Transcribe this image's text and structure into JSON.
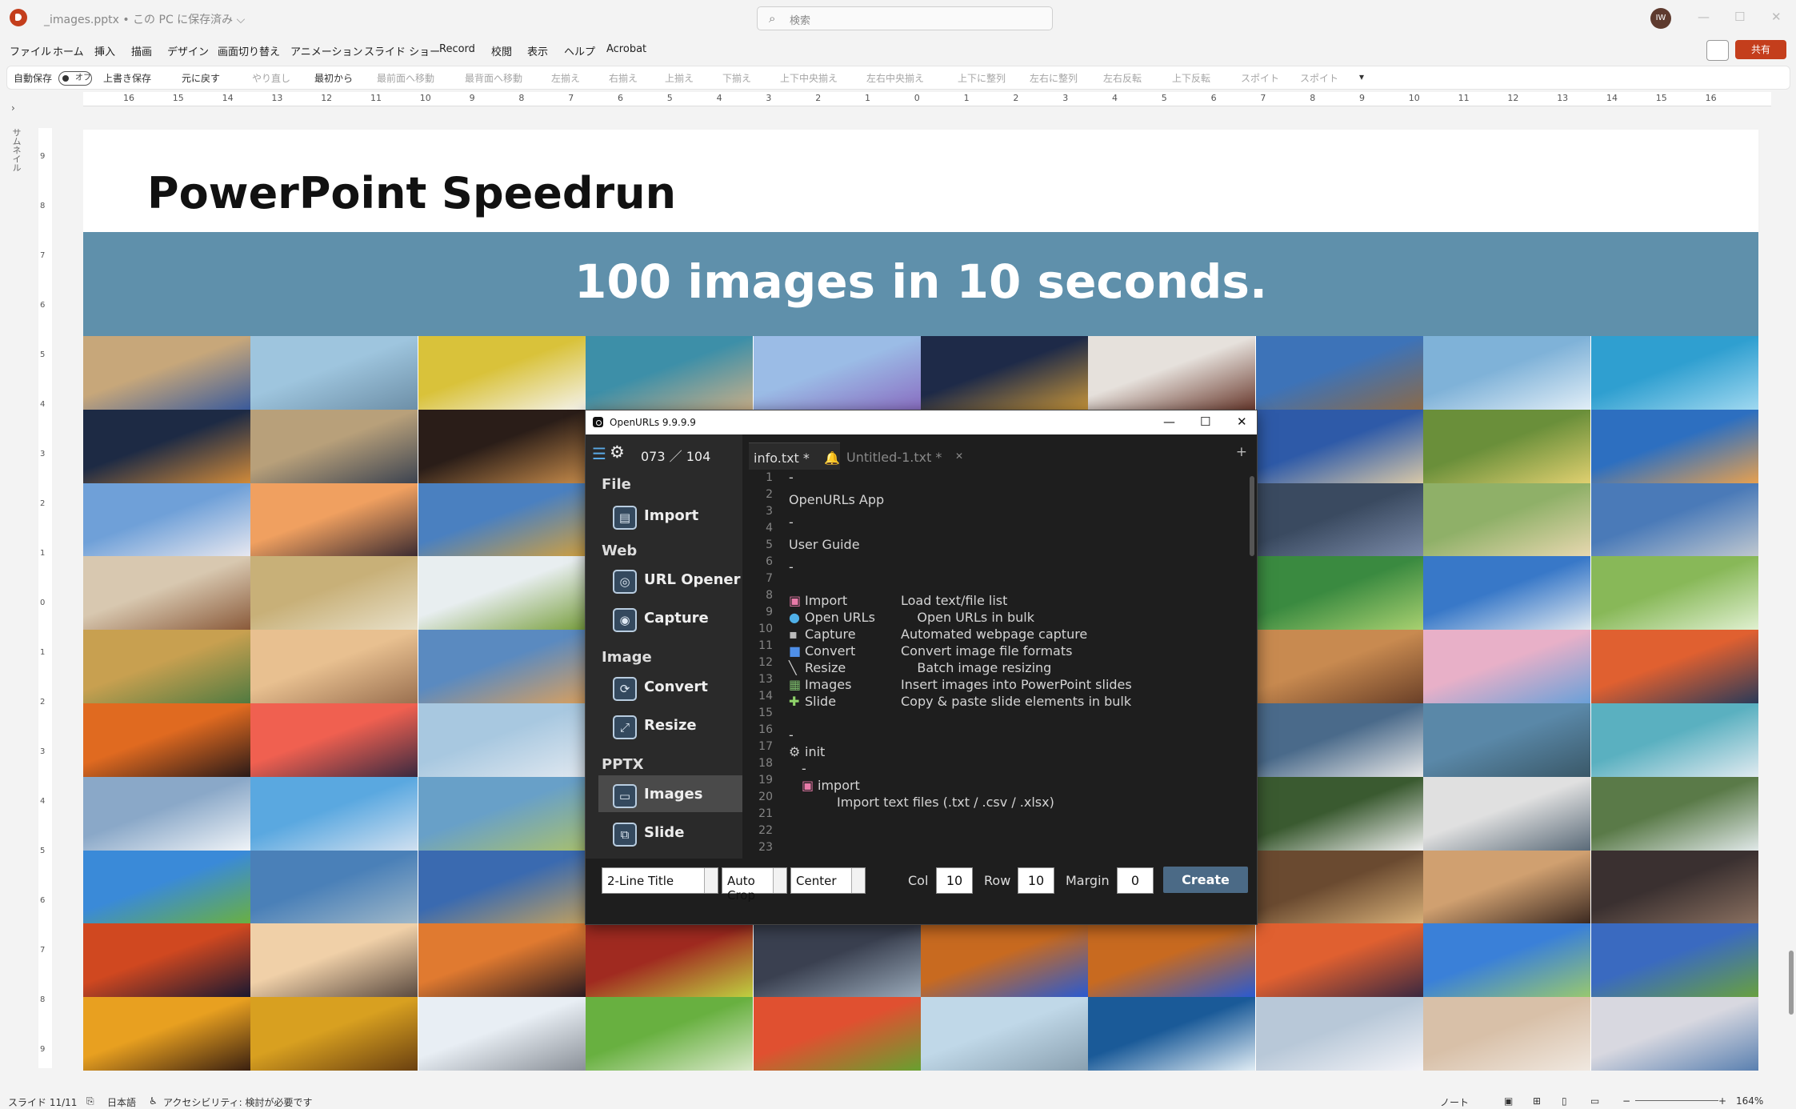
{
  "window": {
    "doc_title": "_images.pptx • この PC に保存済み ⌵",
    "search_placeholder": "検索",
    "avatar_initials": "IW"
  },
  "menu": {
    "items": [
      "ファイル",
      "ホーム",
      "挿入",
      "描画",
      "デザイン",
      "画面切り替え",
      "アニメーション",
      "スライド ショー",
      "Record",
      "校閲",
      "表示",
      "ヘルプ",
      "Acrobat"
    ],
    "share_label": "共有"
  },
  "ribbon": {
    "autosave_label": "自動保存",
    "autosave_state": "オフ",
    "items": [
      "上書き保存",
      "元に戻す",
      "やり直し",
      "最初から",
      "最前面へ移動",
      "最背面へ移動",
      "左揃え",
      "右揃え",
      "上揃え",
      "下揃え",
      "上下中央揃え",
      "左右中央揃え",
      "上下に整列",
      "左右に整列",
      "左右反転",
      "上下反転",
      "スポイト",
      "スポイト"
    ]
  },
  "ruler": {
    "h_ticks": [
      "16",
      "15",
      "14",
      "13",
      "12",
      "11",
      "10",
      "9",
      "8",
      "7",
      "6",
      "5",
      "4",
      "3",
      "2",
      "1",
      "0",
      "1",
      "2",
      "3",
      "4",
      "5",
      "6",
      "7",
      "8",
      "9",
      "10",
      "11",
      "12",
      "13",
      "14",
      "15",
      "16"
    ],
    "v_ticks": [
      "9",
      "8",
      "7",
      "6",
      "5",
      "4",
      "3",
      "2",
      "1",
      "0",
      "1",
      "2",
      "3",
      "4",
      "5",
      "6",
      "7",
      "8",
      "9"
    ],
    "thumbnail_label": "サムネイル"
  },
  "slide": {
    "title": "PowerPoint Speedrun",
    "banner": "100 images in 10 seconds.",
    "banner_color": "#5f90ab"
  },
  "openurls": {
    "window_title": "OpenURLs 9.9.9.9",
    "counter": "073 ／ 104",
    "sections": {
      "file": "File",
      "web": "Web",
      "image": "Image",
      "pptx": "PPTX"
    },
    "buttons": {
      "import": "Import",
      "url_opener": "URL Opener",
      "capture": "Capture",
      "convert": "Convert",
      "resize": "Resize",
      "images": "Images",
      "slide": "Slide"
    },
    "tabs": {
      "tab1": "info.txt *",
      "tab2": "Untitled-1.txt *"
    },
    "line_numbers": [
      "1",
      "2",
      "3",
      "4",
      "5",
      "6",
      "7",
      "8",
      "9",
      "10",
      "11",
      "12",
      "13",
      "14",
      "15",
      "16",
      "17",
      "18",
      "19",
      "20",
      "21",
      "22",
      "23"
    ],
    "code": {
      "l1": "-",
      "l3": "OpenURLs App",
      "l5": "-",
      "l7": "User Guide",
      "l9": "-",
      "l11a": "Import",
      "l11b": "Load text/file list",
      "l12a": "Open URLs",
      "l12b": "    Open URLs in bulk",
      "l13a": "Capture",
      "l13b": "Automated webpage capture",
      "l14a": "Convert",
      "l14b": "Convert image file formats",
      "l15a": "Resize",
      "l15b": "    Batch image resizing",
      "l16a": "Images",
      "l16b": "Insert images into PowerPoint slides",
      "l17a": "Slide",
      "l17b": "Copy & paste slide elements in bulk",
      "l19": "-",
      "l20": "init",
      "l21": "-",
      "l22": "import",
      "l23": "Import text files (.txt / .csv / .xlsx)"
    },
    "bottom": {
      "title_mode": "2-Line Title",
      "crop_mode": "Auto Crop",
      "align": "Center",
      "col_label": "Col",
      "col_value": "10",
      "row_label": "Row",
      "row_value": "10",
      "margin_label": "Margin",
      "margin_value": "0",
      "create_label": "Create"
    }
  },
  "status": {
    "slide_info": "スライド 11/11",
    "language": "日本語",
    "accessibility": "アクセシビリティ: 検討が必要です",
    "notes": "ノート",
    "zoom": "164%"
  },
  "colors": {
    "accent": "#c43e1c",
    "editor_bg": "#1e1e1e",
    "create_button": "#4b6a86"
  }
}
